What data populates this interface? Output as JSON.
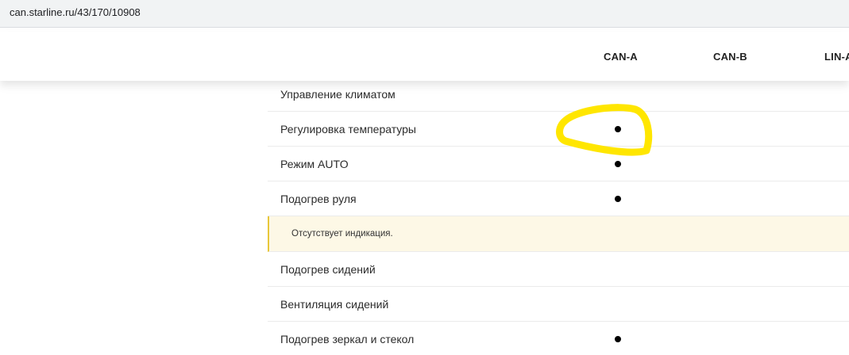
{
  "browser": {
    "url": "can.starline.ru/43/170/10908"
  },
  "columns": [
    "CAN-A",
    "CAN-B",
    "LIN-A"
  ],
  "rows": [
    {
      "label": "Управление климатом",
      "dot": false
    },
    {
      "label": "Регулировка температуры",
      "dot": true
    },
    {
      "label": "Режим AUTO",
      "dot": true
    },
    {
      "label": "Подогрев руля",
      "dot": true
    },
    {
      "label": "Отсутствует индикация.",
      "dot": false,
      "note": true
    },
    {
      "label": "Подогрев сидений",
      "dot": false
    },
    {
      "label": "Вентиляция сидений",
      "dot": false
    },
    {
      "label": "Подогрев зеркал и стекол",
      "dot": true
    }
  ],
  "colors": {
    "highlight": "#ffe600",
    "note_bg": "#fdf8e6",
    "note_border": "#e8c73a"
  }
}
